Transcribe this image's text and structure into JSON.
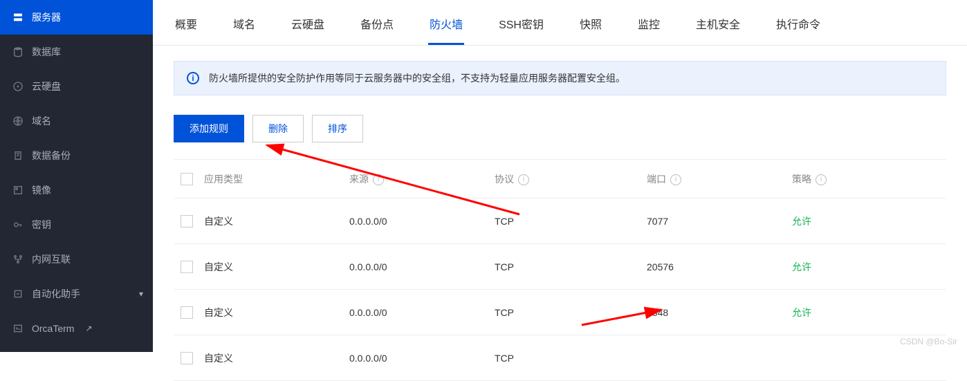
{
  "sidebar": {
    "items": [
      {
        "label": "服务器",
        "active": true
      },
      {
        "label": "数据库"
      },
      {
        "label": "云硬盘"
      },
      {
        "label": "域名"
      },
      {
        "label": "数据备份"
      },
      {
        "label": "镜像"
      },
      {
        "label": "密钥"
      },
      {
        "label": "内网互联"
      },
      {
        "label": "自动化助手",
        "expandable": true
      },
      {
        "label": "OrcaTerm",
        "external": true
      }
    ]
  },
  "tabs": {
    "items": [
      "概要",
      "域名",
      "云硬盘",
      "备份点",
      "防火墙",
      "SSH密钥",
      "快照",
      "监控",
      "主机安全",
      "执行命令"
    ],
    "active": "防火墙"
  },
  "notice": "防火墙所提供的安全防护作用等同于云服务器中的安全组，不支持为轻量应用服务器配置安全组。",
  "toolbar": {
    "add": "添加规则",
    "del": "删除",
    "sort": "排序"
  },
  "table": {
    "head": {
      "type": "应用类型",
      "src": "来源",
      "proto": "协议",
      "port": "端口",
      "policy": "策略"
    },
    "rows": [
      {
        "type": "自定义",
        "src": "0.0.0.0/0",
        "proto": "TCP",
        "port": "7077",
        "policy": "允许"
      },
      {
        "type": "自定义",
        "src": "0.0.0.0/0",
        "proto": "TCP",
        "port": "20576",
        "policy": "允许"
      },
      {
        "type": "自定义",
        "src": "0.0.0.0/0",
        "proto": "TCP",
        "port": "8848",
        "policy": "允许"
      },
      {
        "type": "自定义",
        "src": "0.0.0.0/0",
        "proto": "TCP",
        "port": "",
        "policy": ""
      }
    ]
  },
  "watermark": "CSDN @Bo-Sir"
}
